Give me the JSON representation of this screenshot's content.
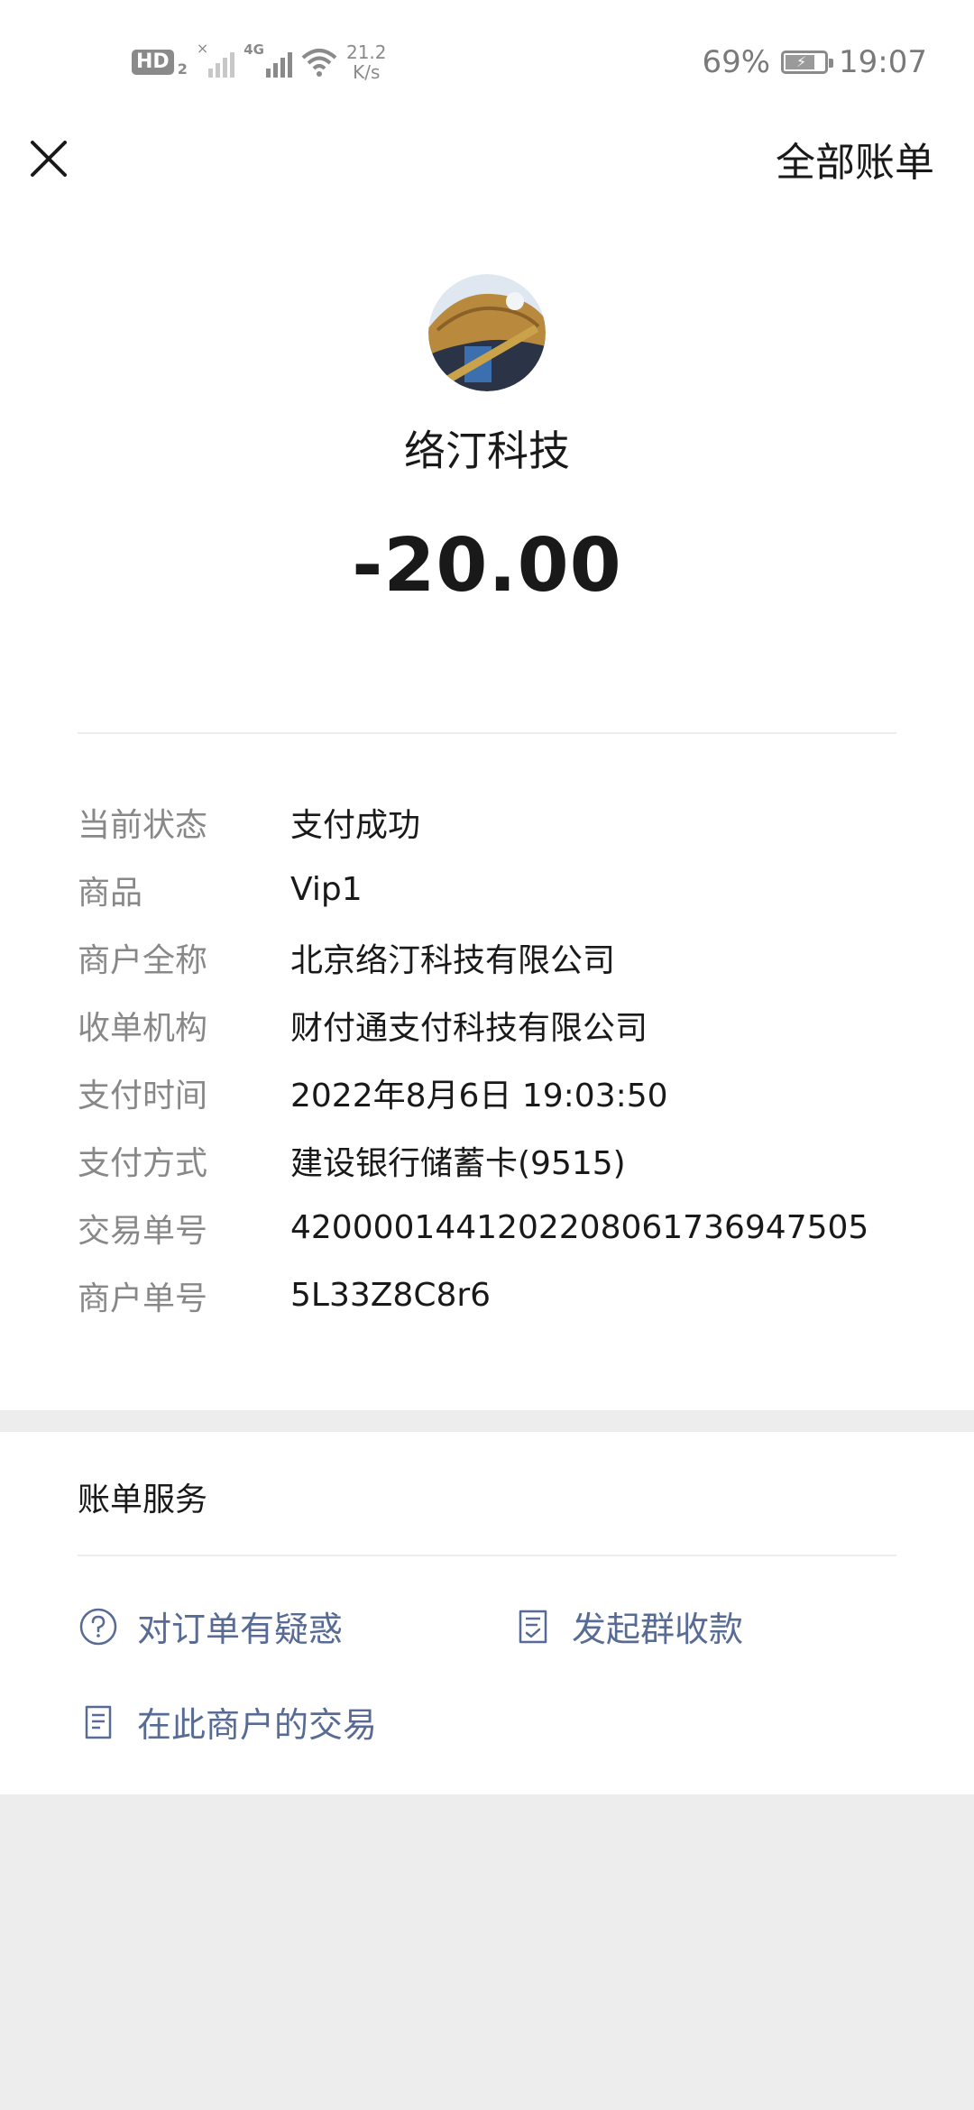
{
  "status_bar": {
    "hd_label": "HD",
    "hd_sub": "2",
    "network_label": "4G",
    "no_signal_mark": "×",
    "speed_value": "21.2",
    "speed_unit": "K/s",
    "battery_percent": "69%",
    "battery_level": 0.69,
    "time": "19:07"
  },
  "topbar": {
    "right_label": "全部账单"
  },
  "transaction": {
    "merchant_name": "络汀科技",
    "amount": "-20.00",
    "details": [
      {
        "key": "当前状态",
        "value": "支付成功"
      },
      {
        "key": "商品",
        "value": "Vip1"
      },
      {
        "key": "商户全称",
        "value": "北京络汀科技有限公司"
      },
      {
        "key": "收单机构",
        "value": "财付通支付科技有限公司"
      },
      {
        "key": "支付时间",
        "value": "2022年8月6日 19:03:50"
      },
      {
        "key": "支付方式",
        "value": "建设银行储蓄卡(9515)"
      },
      {
        "key": "交易单号",
        "value": "4200001441202208061736947505"
      },
      {
        "key": "商户单号",
        "value": "5L33Z8C8r6"
      }
    ]
  },
  "services": {
    "title": "账单服务",
    "question_label": "对订单有疑惑",
    "group_collect_label": "发起群收款",
    "merchant_trades_label": "在此商户的交易"
  },
  "colors": {
    "link": "#576b95",
    "label_gray": "#888888",
    "background": "#ededed"
  }
}
